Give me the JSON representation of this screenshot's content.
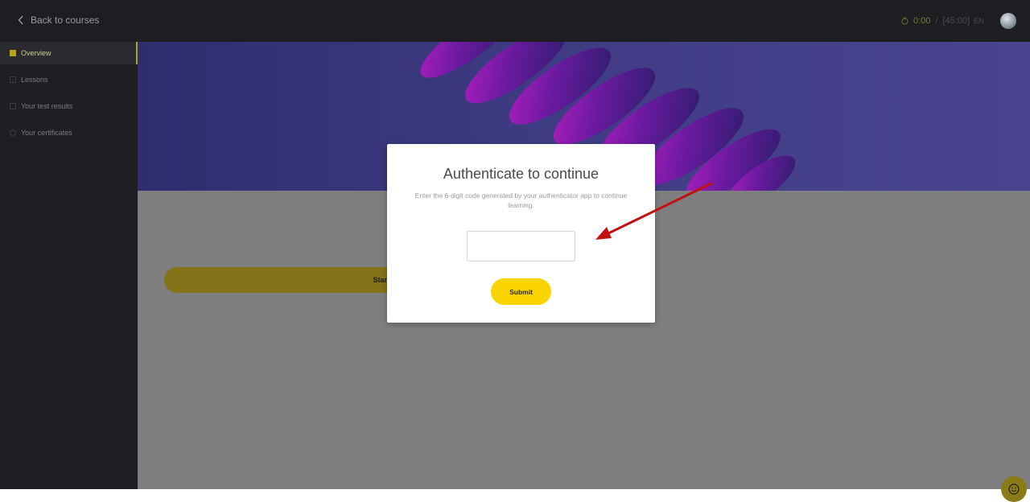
{
  "topbar": {
    "back_label": "Back to courses",
    "timer_current": "0:00",
    "timer_separator": "/",
    "timer_total": "[45:00]",
    "lang": "EN"
  },
  "sidebar": {
    "items": [
      {
        "label": "Overview",
        "icon": "overview-icon",
        "active": true
      },
      {
        "label": "Lessons",
        "icon": "lessons-icon",
        "active": false
      },
      {
        "label": "Your test results",
        "icon": "results-icon",
        "active": false
      },
      {
        "label": "Your certificates",
        "icon": "certificate-icon",
        "active": false
      }
    ]
  },
  "main": {
    "start_label": "Start"
  },
  "modal": {
    "title": "Authenticate to continue",
    "description": "Enter the 6-digit code generated by your authenticator app to continue learning.",
    "code_value": "",
    "code_placeholder": "",
    "submit_label": "Submit"
  },
  "colors": {
    "accent": "#fad400",
    "sidebar_bg": "#1f1f23",
    "topbar_bg": "#1e1e22",
    "overlay_gray": "#7e7e7e",
    "hero_purple": "#3f3b83",
    "arrow_red": "#c01010"
  }
}
